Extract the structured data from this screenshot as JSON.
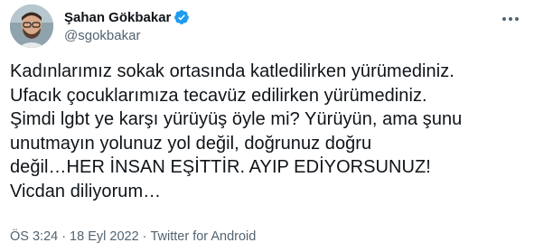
{
  "author": {
    "display_name": "Şahan Gökbakar",
    "handle": "@sgokbakar",
    "verified": true,
    "avatar_icon": "profile-photo"
  },
  "tweet": {
    "text": "Kadınlarımız sokak ortasında katledilirken yürümediniz.\nUfacık çocuklarımıza tecavüz edilirken yürümediniz.\nŞimdi lgbt ye karşı yürüyüş öyle mi? Yürüyün, ama şunu\nunutmayın yolunuz yol değil, doğrunuz doğru\ndeğil…HER İNSAN EŞİTTİR. AYIP EDİYORSUNUZ!\nVicdan diliyorum…",
    "time": "ÖS 3:24",
    "separator": "·",
    "date": "18 Eyl 2022",
    "source": "Twitter for Android"
  },
  "icons": {
    "verified": "verified-badge-icon",
    "more": "more-options-icon"
  },
  "colors": {
    "text": "#0f1419",
    "secondary": "#536471",
    "verified": "#1d9bf0"
  }
}
